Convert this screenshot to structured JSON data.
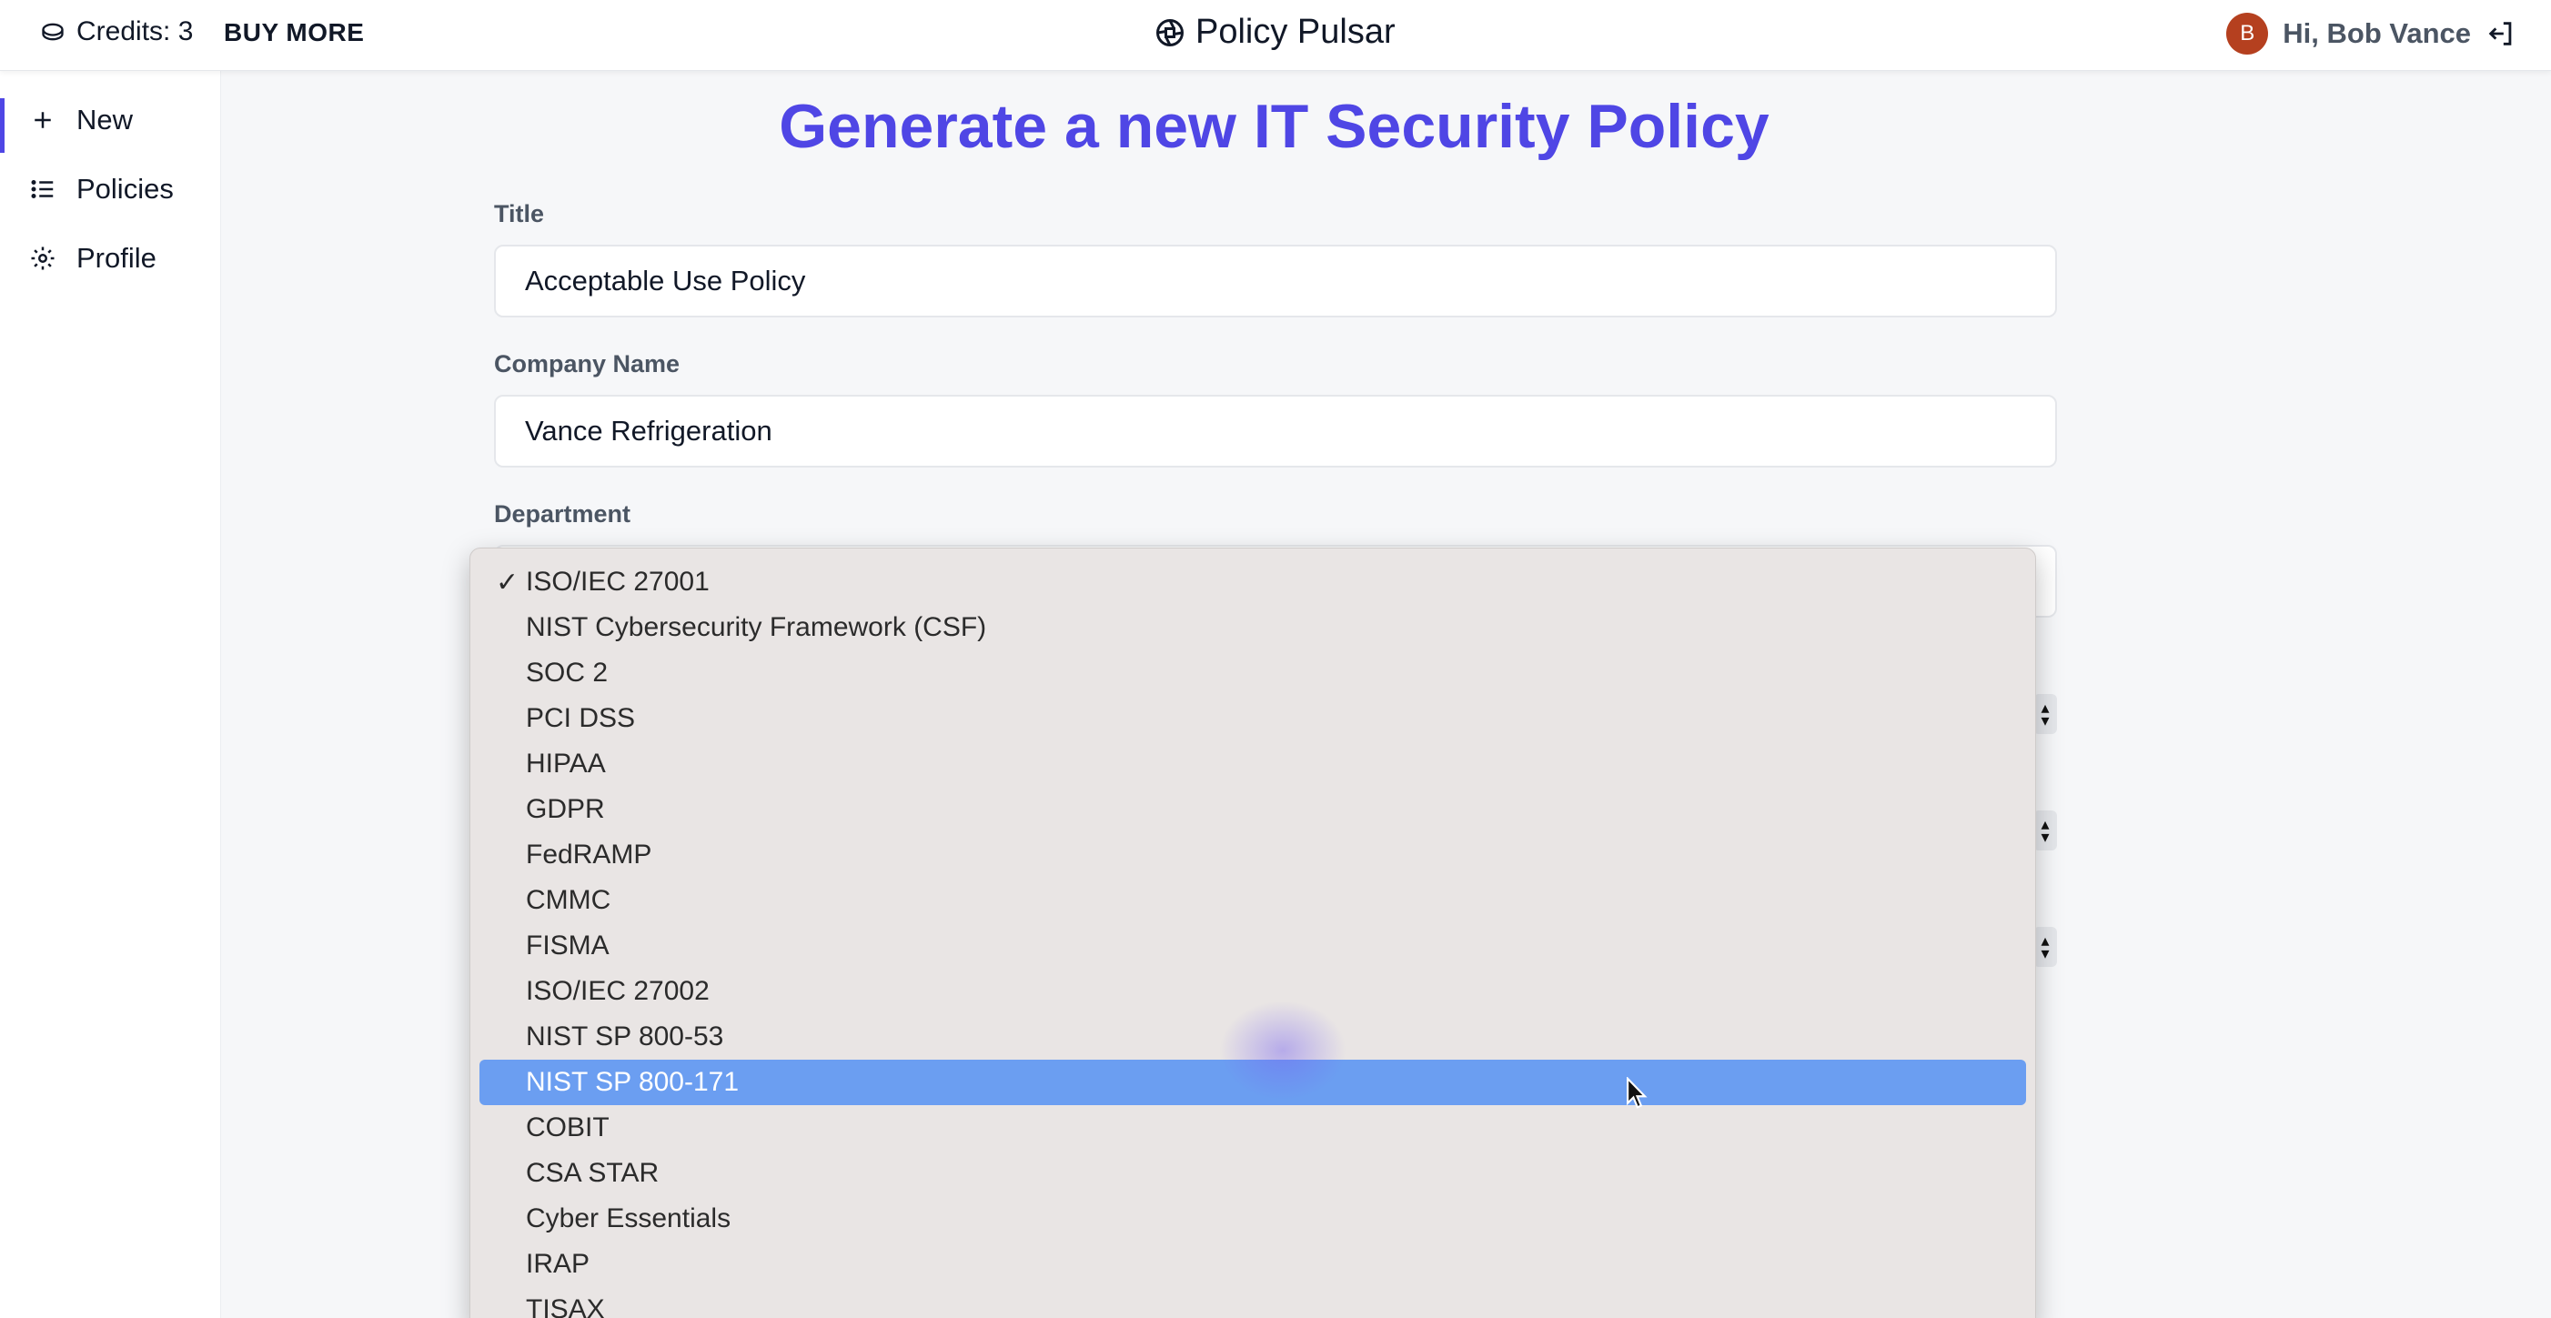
{
  "header": {
    "credits_label": "Credits: 3",
    "buy_more_label": "BUY MORE",
    "brand_name": "Policy Pulsar",
    "user_greeting": "Hi, Bob Vance",
    "avatar_initial": "B"
  },
  "sidebar": {
    "items": [
      {
        "label": "New",
        "icon": "plus-icon",
        "active": true
      },
      {
        "label": "Policies",
        "icon": "list-icon",
        "active": false
      },
      {
        "label": "Profile",
        "icon": "gear-icon",
        "active": false
      }
    ]
  },
  "main": {
    "heading": "Generate a new IT Security Policy",
    "title_label": "Title",
    "title_value": "Acceptable Use Policy",
    "company_label": "Company Name",
    "company_value": "Vance Refrigeration",
    "department_label": "Department"
  },
  "dropdown": {
    "selected": "ISO/IEC 27001",
    "highlighted": "NIST SP 800-171",
    "options": [
      "ISO/IEC 27001",
      "NIST Cybersecurity Framework (CSF)",
      "SOC 2",
      "PCI DSS",
      "HIPAA",
      "GDPR",
      "FedRAMP",
      "CMMC",
      "FISMA",
      "ISO/IEC 27002",
      "NIST SP 800-53",
      "NIST SP 800-171",
      "COBIT",
      "CSA STAR",
      "Cyber Essentials",
      "IRAP",
      "TISAX"
    ]
  },
  "colors": {
    "accent": "#4f46e5",
    "highlight": "#6b9ef1",
    "avatar": "#b5401f",
    "dropdown_bg": "#e9e5e4"
  }
}
